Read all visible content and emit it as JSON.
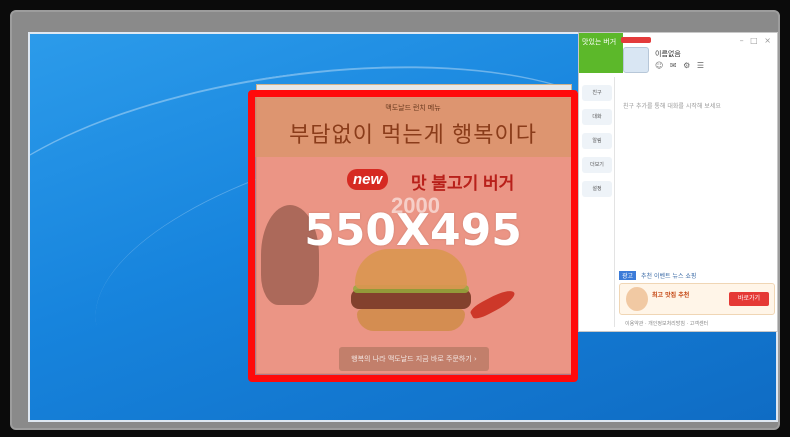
{
  "overlay": {
    "size_label": "550X495",
    "border_color": "#ff0a0a"
  },
  "ad_popup": {
    "kicker": "맥도날드 런치 메뉴",
    "headline": "부담없이 먹는게 행복이다",
    "badge": "new",
    "product": "맛 불고기 버거",
    "price": "2000",
    "cta": "행복의 나라 맥도날드 지금 바로 주문하기 ›"
  },
  "messenger": {
    "banner_text": "맛있는 버거",
    "profile_name": "이름없음",
    "top_icons": "☺ ✉ ⚙ ☰",
    "window_controls": "– □ ×",
    "sidebar": [
      {
        "label": "친구"
      },
      {
        "label": "대화"
      },
      {
        "label": "알림"
      },
      {
        "label": "더보기"
      },
      {
        "label": "설정"
      }
    ],
    "empty_text": "친구 추가를 통해 대화를 시작해 보세요",
    "tabs": [
      "광고",
      "추천",
      "이벤트",
      "뉴스",
      "쇼핑"
    ],
    "ad_text": "최고 맛집 추천",
    "ad_button": "바로가기",
    "footer": "이용약관 · 개인정보처리방침 · 고객센터"
  },
  "colors": {
    "desktop": "#1784dd",
    "overlay_fill": "rgba(232,120,110,0.72)",
    "messenger_accent": "#5cb82a"
  }
}
